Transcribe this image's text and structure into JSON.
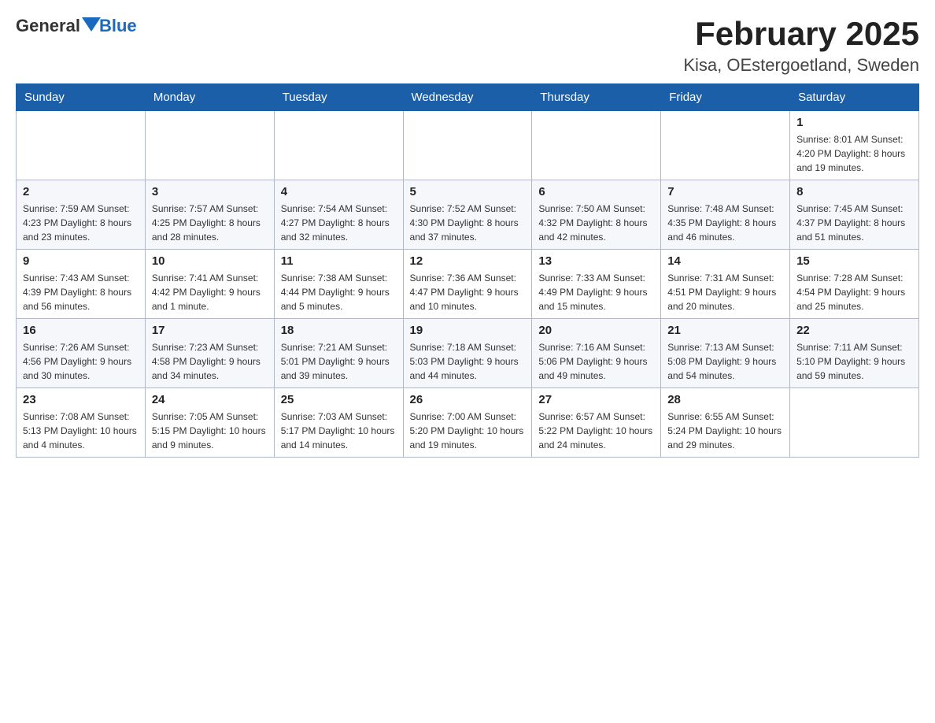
{
  "logo": {
    "general": "General",
    "blue": "Blue"
  },
  "header": {
    "month_year": "February 2025",
    "location": "Kisa, OEstergoetland, Sweden"
  },
  "weekdays": [
    "Sunday",
    "Monday",
    "Tuesday",
    "Wednesday",
    "Thursday",
    "Friday",
    "Saturday"
  ],
  "weeks": [
    [
      {
        "day": "",
        "info": ""
      },
      {
        "day": "",
        "info": ""
      },
      {
        "day": "",
        "info": ""
      },
      {
        "day": "",
        "info": ""
      },
      {
        "day": "",
        "info": ""
      },
      {
        "day": "",
        "info": ""
      },
      {
        "day": "1",
        "info": "Sunrise: 8:01 AM\nSunset: 4:20 PM\nDaylight: 8 hours and 19 minutes."
      }
    ],
    [
      {
        "day": "2",
        "info": "Sunrise: 7:59 AM\nSunset: 4:23 PM\nDaylight: 8 hours and 23 minutes."
      },
      {
        "day": "3",
        "info": "Sunrise: 7:57 AM\nSunset: 4:25 PM\nDaylight: 8 hours and 28 minutes."
      },
      {
        "day": "4",
        "info": "Sunrise: 7:54 AM\nSunset: 4:27 PM\nDaylight: 8 hours and 32 minutes."
      },
      {
        "day": "5",
        "info": "Sunrise: 7:52 AM\nSunset: 4:30 PM\nDaylight: 8 hours and 37 minutes."
      },
      {
        "day": "6",
        "info": "Sunrise: 7:50 AM\nSunset: 4:32 PM\nDaylight: 8 hours and 42 minutes."
      },
      {
        "day": "7",
        "info": "Sunrise: 7:48 AM\nSunset: 4:35 PM\nDaylight: 8 hours and 46 minutes."
      },
      {
        "day": "8",
        "info": "Sunrise: 7:45 AM\nSunset: 4:37 PM\nDaylight: 8 hours and 51 minutes."
      }
    ],
    [
      {
        "day": "9",
        "info": "Sunrise: 7:43 AM\nSunset: 4:39 PM\nDaylight: 8 hours and 56 minutes."
      },
      {
        "day": "10",
        "info": "Sunrise: 7:41 AM\nSunset: 4:42 PM\nDaylight: 9 hours and 1 minute."
      },
      {
        "day": "11",
        "info": "Sunrise: 7:38 AM\nSunset: 4:44 PM\nDaylight: 9 hours and 5 minutes."
      },
      {
        "day": "12",
        "info": "Sunrise: 7:36 AM\nSunset: 4:47 PM\nDaylight: 9 hours and 10 minutes."
      },
      {
        "day": "13",
        "info": "Sunrise: 7:33 AM\nSunset: 4:49 PM\nDaylight: 9 hours and 15 minutes."
      },
      {
        "day": "14",
        "info": "Sunrise: 7:31 AM\nSunset: 4:51 PM\nDaylight: 9 hours and 20 minutes."
      },
      {
        "day": "15",
        "info": "Sunrise: 7:28 AM\nSunset: 4:54 PM\nDaylight: 9 hours and 25 minutes."
      }
    ],
    [
      {
        "day": "16",
        "info": "Sunrise: 7:26 AM\nSunset: 4:56 PM\nDaylight: 9 hours and 30 minutes."
      },
      {
        "day": "17",
        "info": "Sunrise: 7:23 AM\nSunset: 4:58 PM\nDaylight: 9 hours and 34 minutes."
      },
      {
        "day": "18",
        "info": "Sunrise: 7:21 AM\nSunset: 5:01 PM\nDaylight: 9 hours and 39 minutes."
      },
      {
        "day": "19",
        "info": "Sunrise: 7:18 AM\nSunset: 5:03 PM\nDaylight: 9 hours and 44 minutes."
      },
      {
        "day": "20",
        "info": "Sunrise: 7:16 AM\nSunset: 5:06 PM\nDaylight: 9 hours and 49 minutes."
      },
      {
        "day": "21",
        "info": "Sunrise: 7:13 AM\nSunset: 5:08 PM\nDaylight: 9 hours and 54 minutes."
      },
      {
        "day": "22",
        "info": "Sunrise: 7:11 AM\nSunset: 5:10 PM\nDaylight: 9 hours and 59 minutes."
      }
    ],
    [
      {
        "day": "23",
        "info": "Sunrise: 7:08 AM\nSunset: 5:13 PM\nDaylight: 10 hours and 4 minutes."
      },
      {
        "day": "24",
        "info": "Sunrise: 7:05 AM\nSunset: 5:15 PM\nDaylight: 10 hours and 9 minutes."
      },
      {
        "day": "25",
        "info": "Sunrise: 7:03 AM\nSunset: 5:17 PM\nDaylight: 10 hours and 14 minutes."
      },
      {
        "day": "26",
        "info": "Sunrise: 7:00 AM\nSunset: 5:20 PM\nDaylight: 10 hours and 19 minutes."
      },
      {
        "day": "27",
        "info": "Sunrise: 6:57 AM\nSunset: 5:22 PM\nDaylight: 10 hours and 24 minutes."
      },
      {
        "day": "28",
        "info": "Sunrise: 6:55 AM\nSunset: 5:24 PM\nDaylight: 10 hours and 29 minutes."
      },
      {
        "day": "",
        "info": ""
      }
    ]
  ]
}
